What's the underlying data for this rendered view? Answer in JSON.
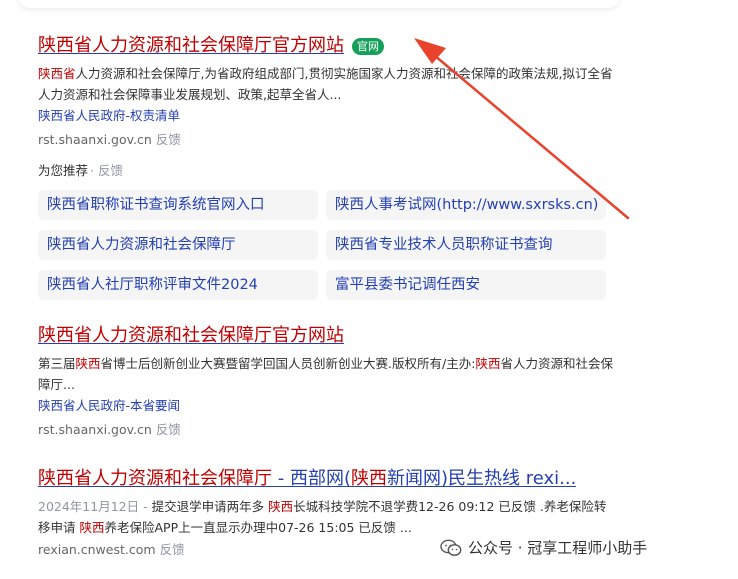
{
  "results": [
    {
      "title_hl": "陕西省人力资源和社会保障厅官方网站",
      "title_rest": "",
      "badge": "官网",
      "snippet_parts": [
        {
          "t": "陕西省",
          "hl": true
        },
        {
          "t": "人力资源和社会保障厅,为省政府组成部门,贯彻实施国家人力资源和社会保障的政策法规,拟订全省人力资源和社会保障事业发展规划、政策,起草全省人...",
          "hl": false
        }
      ],
      "link": "陕西省人民政府-权责清单",
      "site": "rst.shaanxi.gov.cn",
      "feedback": "反馈"
    },
    {
      "title_hl": "陕西省人力资源和社会保障厅官方网站",
      "title_rest": "",
      "snippet_parts": [
        {
          "t": "第三届",
          "hl": false
        },
        {
          "t": "陕西",
          "hl": true
        },
        {
          "t": "省博士后创新创业大赛暨留学回国人员创新创业大赛.版权所有/主办:",
          "hl": false
        },
        {
          "t": "陕西",
          "hl": true
        },
        {
          "t": "省人力资源和社会保障厅...",
          "hl": false
        }
      ],
      "link": "陕西省人民政府-本省要闻",
      "site": "rst.shaanxi.gov.cn",
      "feedback": "反馈"
    },
    {
      "title_parts": [
        {
          "t": "陕西省人力资源和社会保障厅",
          "hl": true
        },
        {
          "t": " - 西部网(",
          "hl": false
        },
        {
          "t": "陕西",
          "hl": true
        },
        {
          "t": "新闻网)民生热线 rexi...",
          "hl": false
        }
      ],
      "date": "2024年11月12日 -",
      "snippet_parts": [
        {
          "t": " 提交退学申请两年多 ",
          "hl": false
        },
        {
          "t": "陕西",
          "hl": true
        },
        {
          "t": "长城科技学院不退学费12-26 09:12 已反馈 .养老保险转移申请 ",
          "hl": false
        },
        {
          "t": "陕西",
          "hl": true
        },
        {
          "t": "养老保险APP上一直显示办理中07-26 15:05 已反馈 ...",
          "hl": false
        }
      ],
      "site": "rexian.cnwest.com",
      "feedback": "反馈"
    }
  ],
  "recommend": {
    "label": "为您推荐",
    "feedback": "· 反馈",
    "items": [
      "陕西省职称证书查询系统官网入口",
      "陕西人事考试网(http://www.sxrsks.cn)",
      "陕西省人力资源和社会保障厅",
      "陕西省专业技术人员职称证书查询",
      "陕西省人社厅职称评审文件2024",
      "富平县委书记调任西安"
    ]
  },
  "watermark": {
    "text": "公众号 · 冠享工程师小助手",
    "icon": "wechat-icon"
  },
  "colors": {
    "link": "#2440b3",
    "highlight": "#c00000",
    "badge": "#14a05a",
    "arrow": "#e8432c"
  }
}
